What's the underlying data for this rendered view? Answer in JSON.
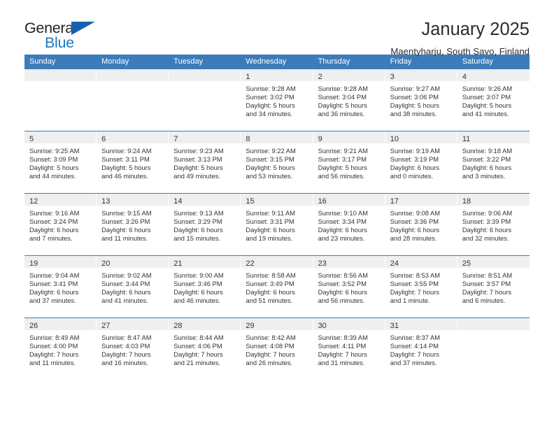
{
  "logo": {
    "word_top": "General",
    "word_bottom": "Blue",
    "triangle_color": "#1263ac",
    "blue_color": "#1c79c4"
  },
  "header": {
    "title": "January 2025",
    "subtitle": "Maentyharju, South Savo, Finland"
  },
  "theme": {
    "header_blue": "#3d7cba",
    "daynum_band": "#efefef",
    "text": "#333333"
  },
  "weekdays": [
    "Sunday",
    "Monday",
    "Tuesday",
    "Wednesday",
    "Thursday",
    "Friday",
    "Saturday"
  ],
  "weeks": [
    [
      {
        "day": "",
        "empty": true
      },
      {
        "day": "",
        "empty": true
      },
      {
        "day": "",
        "empty": true
      },
      {
        "day": "1",
        "sunrise": "Sunrise: 9:28 AM",
        "sunset": "Sunset: 3:02 PM",
        "daylight1": "Daylight: 5 hours",
        "daylight2": "and 34 minutes."
      },
      {
        "day": "2",
        "sunrise": "Sunrise: 9:28 AM",
        "sunset": "Sunset: 3:04 PM",
        "daylight1": "Daylight: 5 hours",
        "daylight2": "and 36 minutes."
      },
      {
        "day": "3",
        "sunrise": "Sunrise: 9:27 AM",
        "sunset": "Sunset: 3:06 PM",
        "daylight1": "Daylight: 5 hours",
        "daylight2": "and 38 minutes."
      },
      {
        "day": "4",
        "sunrise": "Sunrise: 9:26 AM",
        "sunset": "Sunset: 3:07 PM",
        "daylight1": "Daylight: 5 hours",
        "daylight2": "and 41 minutes."
      }
    ],
    [
      {
        "day": "5",
        "sunrise": "Sunrise: 9:25 AM",
        "sunset": "Sunset: 3:09 PM",
        "daylight1": "Daylight: 5 hours",
        "daylight2": "and 44 minutes."
      },
      {
        "day": "6",
        "sunrise": "Sunrise: 9:24 AM",
        "sunset": "Sunset: 3:11 PM",
        "daylight1": "Daylight: 5 hours",
        "daylight2": "and 46 minutes."
      },
      {
        "day": "7",
        "sunrise": "Sunrise: 9:23 AM",
        "sunset": "Sunset: 3:13 PM",
        "daylight1": "Daylight: 5 hours",
        "daylight2": "and 49 minutes."
      },
      {
        "day": "8",
        "sunrise": "Sunrise: 9:22 AM",
        "sunset": "Sunset: 3:15 PM",
        "daylight1": "Daylight: 5 hours",
        "daylight2": "and 53 minutes."
      },
      {
        "day": "9",
        "sunrise": "Sunrise: 9:21 AM",
        "sunset": "Sunset: 3:17 PM",
        "daylight1": "Daylight: 5 hours",
        "daylight2": "and 56 minutes."
      },
      {
        "day": "10",
        "sunrise": "Sunrise: 9:19 AM",
        "sunset": "Sunset: 3:19 PM",
        "daylight1": "Daylight: 6 hours",
        "daylight2": "and 0 minutes."
      },
      {
        "day": "11",
        "sunrise": "Sunrise: 9:18 AM",
        "sunset": "Sunset: 3:22 PM",
        "daylight1": "Daylight: 6 hours",
        "daylight2": "and 3 minutes."
      }
    ],
    [
      {
        "day": "12",
        "sunrise": "Sunrise: 9:16 AM",
        "sunset": "Sunset: 3:24 PM",
        "daylight1": "Daylight: 6 hours",
        "daylight2": "and 7 minutes."
      },
      {
        "day": "13",
        "sunrise": "Sunrise: 9:15 AM",
        "sunset": "Sunset: 3:26 PM",
        "daylight1": "Daylight: 6 hours",
        "daylight2": "and 11 minutes."
      },
      {
        "day": "14",
        "sunrise": "Sunrise: 9:13 AM",
        "sunset": "Sunset: 3:29 PM",
        "daylight1": "Daylight: 6 hours",
        "daylight2": "and 15 minutes."
      },
      {
        "day": "15",
        "sunrise": "Sunrise: 9:11 AM",
        "sunset": "Sunset: 3:31 PM",
        "daylight1": "Daylight: 6 hours",
        "daylight2": "and 19 minutes."
      },
      {
        "day": "16",
        "sunrise": "Sunrise: 9:10 AM",
        "sunset": "Sunset: 3:34 PM",
        "daylight1": "Daylight: 6 hours",
        "daylight2": "and 23 minutes."
      },
      {
        "day": "17",
        "sunrise": "Sunrise: 9:08 AM",
        "sunset": "Sunset: 3:36 PM",
        "daylight1": "Daylight: 6 hours",
        "daylight2": "and 28 minutes."
      },
      {
        "day": "18",
        "sunrise": "Sunrise: 9:06 AM",
        "sunset": "Sunset: 3:39 PM",
        "daylight1": "Daylight: 6 hours",
        "daylight2": "and 32 minutes."
      }
    ],
    [
      {
        "day": "19",
        "sunrise": "Sunrise: 9:04 AM",
        "sunset": "Sunset: 3:41 PM",
        "daylight1": "Daylight: 6 hours",
        "daylight2": "and 37 minutes."
      },
      {
        "day": "20",
        "sunrise": "Sunrise: 9:02 AM",
        "sunset": "Sunset: 3:44 PM",
        "daylight1": "Daylight: 6 hours",
        "daylight2": "and 41 minutes."
      },
      {
        "day": "21",
        "sunrise": "Sunrise: 9:00 AM",
        "sunset": "Sunset: 3:46 PM",
        "daylight1": "Daylight: 6 hours",
        "daylight2": "and 46 minutes."
      },
      {
        "day": "22",
        "sunrise": "Sunrise: 8:58 AM",
        "sunset": "Sunset: 3:49 PM",
        "daylight1": "Daylight: 6 hours",
        "daylight2": "and 51 minutes."
      },
      {
        "day": "23",
        "sunrise": "Sunrise: 8:56 AM",
        "sunset": "Sunset: 3:52 PM",
        "daylight1": "Daylight: 6 hours",
        "daylight2": "and 56 minutes."
      },
      {
        "day": "24",
        "sunrise": "Sunrise: 8:53 AM",
        "sunset": "Sunset: 3:55 PM",
        "daylight1": "Daylight: 7 hours",
        "daylight2": "and 1 minute."
      },
      {
        "day": "25",
        "sunrise": "Sunrise: 8:51 AM",
        "sunset": "Sunset: 3:57 PM",
        "daylight1": "Daylight: 7 hours",
        "daylight2": "and 6 minutes."
      }
    ],
    [
      {
        "day": "26",
        "sunrise": "Sunrise: 8:49 AM",
        "sunset": "Sunset: 4:00 PM",
        "daylight1": "Daylight: 7 hours",
        "daylight2": "and 11 minutes."
      },
      {
        "day": "27",
        "sunrise": "Sunrise: 8:47 AM",
        "sunset": "Sunset: 4:03 PM",
        "daylight1": "Daylight: 7 hours",
        "daylight2": "and 16 minutes."
      },
      {
        "day": "28",
        "sunrise": "Sunrise: 8:44 AM",
        "sunset": "Sunset: 4:06 PM",
        "daylight1": "Daylight: 7 hours",
        "daylight2": "and 21 minutes."
      },
      {
        "day": "29",
        "sunrise": "Sunrise: 8:42 AM",
        "sunset": "Sunset: 4:08 PM",
        "daylight1": "Daylight: 7 hours",
        "daylight2": "and 26 minutes."
      },
      {
        "day": "30",
        "sunrise": "Sunrise: 8:39 AM",
        "sunset": "Sunset: 4:11 PM",
        "daylight1": "Daylight: 7 hours",
        "daylight2": "and 31 minutes."
      },
      {
        "day": "31",
        "sunrise": "Sunrise: 8:37 AM",
        "sunset": "Sunset: 4:14 PM",
        "daylight1": "Daylight: 7 hours",
        "daylight2": "and 37 minutes."
      },
      {
        "day": "",
        "empty": true
      }
    ]
  ]
}
